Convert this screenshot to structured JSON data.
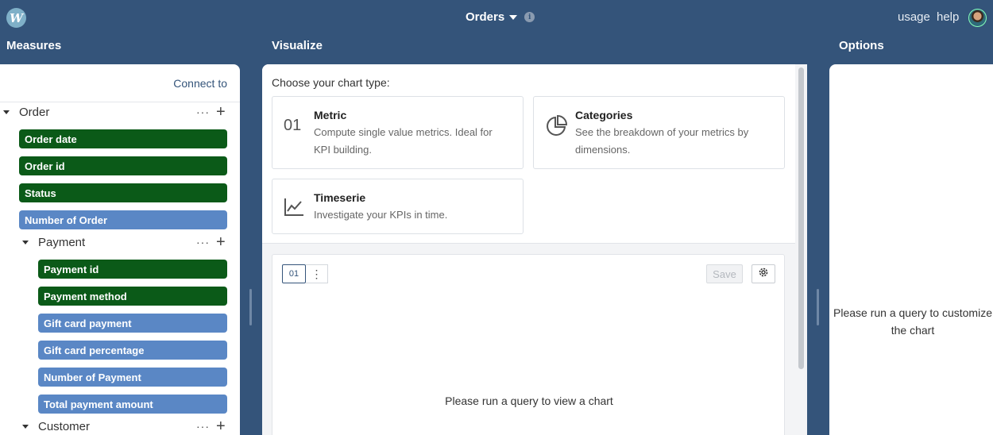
{
  "header": {
    "title": "Orders",
    "links": {
      "usage": "usage",
      "help": "help"
    }
  },
  "sections": {
    "measures": "Measures",
    "visualize": "Visualize",
    "options": "Options"
  },
  "measures": {
    "connect_label": "Connect to",
    "groups": [
      {
        "label": "Order",
        "dots": "···",
        "plus": "+"
      },
      {
        "label": "Payment",
        "dots": "···",
        "plus": "+"
      },
      {
        "label": "Customer",
        "dots": "···",
        "plus": "+"
      }
    ],
    "order_fields": [
      "Order date",
      "Order id",
      "Status",
      "Number of Order"
    ],
    "payment_fields": [
      "Payment id",
      "Payment method",
      "Gift card payment",
      "Gift card percentage",
      "Number of Payment",
      "Total payment amount"
    ]
  },
  "visualize": {
    "choose_label": "Choose your chart type:",
    "cards": [
      {
        "icon_text": "01",
        "title": "Metric",
        "desc_line1": "Compute single value metrics. Ideal for",
        "desc_line2": "KPI building."
      },
      {
        "icon": "pie-chart-icon",
        "title": "Categories",
        "desc_line1": "See the breakdown of your metrics by",
        "desc_line2": "dimensions."
      },
      {
        "icon": "line-chart-icon",
        "title": "Timeserie",
        "desc_line1": "Investigate your KPIs in time."
      }
    ],
    "toolbar": {
      "type_tag": "01",
      "menu": "⋮",
      "save_label": "Save"
    },
    "empty_message": "Please run a query to view a chart"
  },
  "options": {
    "message_line1": "Please run a query to customize",
    "message_line2": "the chart"
  },
  "colors": {
    "header_bg": "#34547a",
    "dimension_pill": "#0b5a18",
    "measure_pill": "#5a87c5"
  }
}
